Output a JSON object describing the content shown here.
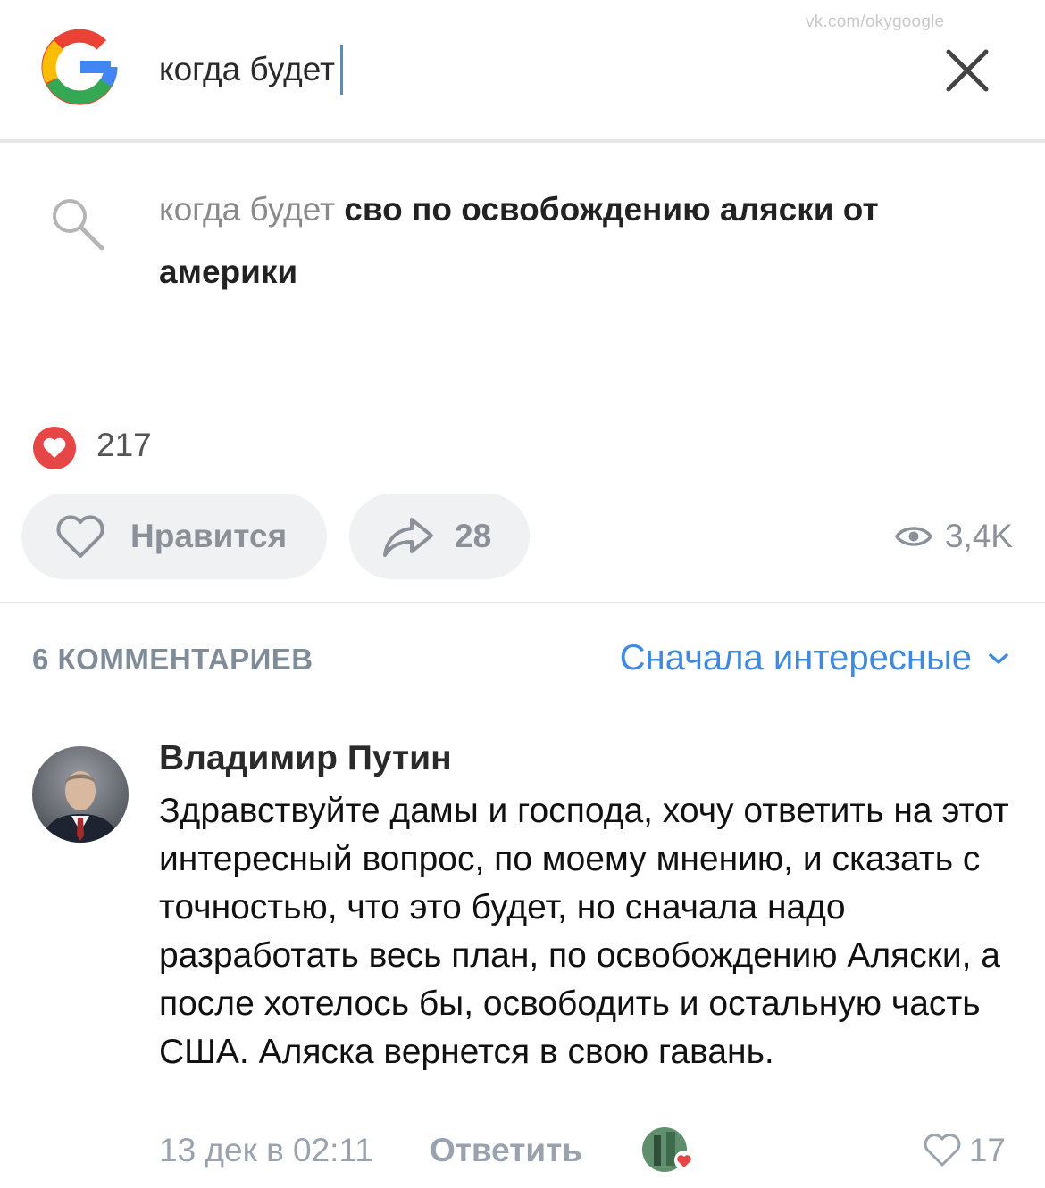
{
  "watermark": "vk.com/okygoogle",
  "search": {
    "query": "когда будет",
    "suggestion_typed": "когда будет",
    "suggestion_completion": "сво по освобождению аляски от америки"
  },
  "post": {
    "reactions_count": "217",
    "like_label": "Нравится",
    "share_count": "28",
    "views": "3,4K"
  },
  "comments": {
    "header": "6 КОММЕНТАРИЕВ",
    "sort_label": "Сначала интересные",
    "items": [
      {
        "author": "Владимир Путин",
        "text": "Здравствуйте дамы и господа, хочу ответить на этот интересный вопрос, по моему мнению, и сказать с точностью, что это будет, но сначала надо разработать весь план, по освобождению Аляски, а после хотелось бы, освободить и остальную часть США. Аляска вернется в свою гавань.",
        "date": "13 дек в 02:11",
        "reply_label": "Ответить",
        "likes": "17"
      }
    ]
  },
  "colors": {
    "accent_blue": "#3f8ae0",
    "heart_red": "#e64646",
    "muted_text": "#99a2ad",
    "pill_bg": "#f0f1f3"
  },
  "icons": {
    "close": "close-icon",
    "search": "search-icon",
    "heart_reaction": "heart-reaction-icon",
    "like": "heart-outline-icon",
    "share": "share-arrow-icon",
    "views": "eye-icon",
    "sort": "chevron-down-icon"
  }
}
